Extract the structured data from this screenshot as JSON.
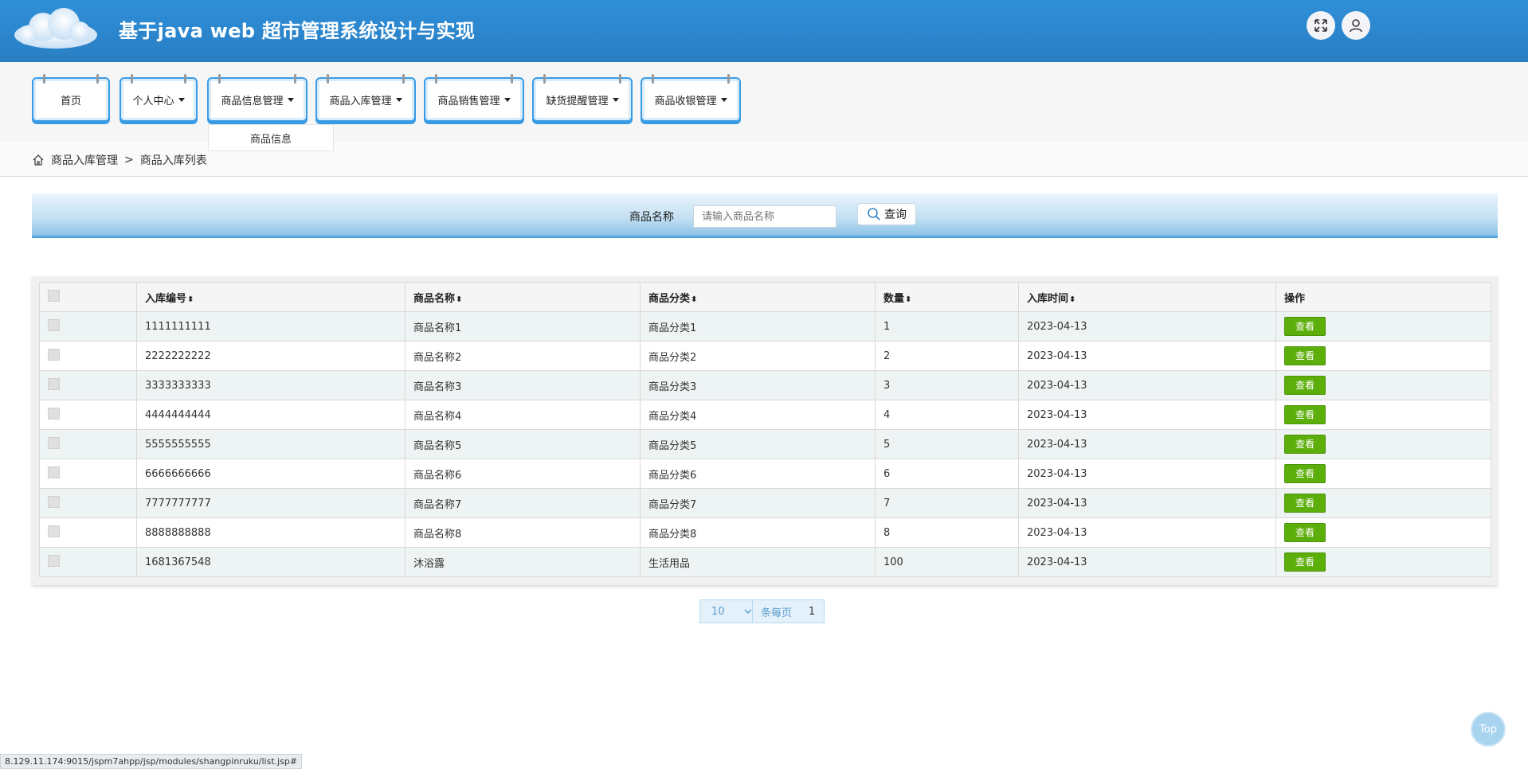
{
  "header": {
    "title": "基于java web 超市管理系统设计与实现",
    "fullscreen_icon": "expand-icon",
    "user_icon": "user-icon"
  },
  "nav": {
    "items": [
      {
        "label": "首页",
        "has_caret": false
      },
      {
        "label": "个人中心",
        "has_caret": true
      },
      {
        "label": "商品信息管理",
        "has_caret": true
      },
      {
        "label": "商品入库管理",
        "has_caret": true
      },
      {
        "label": "商品销售管理",
        "has_caret": true
      },
      {
        "label": "缺货提醒管理",
        "has_caret": true
      },
      {
        "label": "商品收银管理",
        "has_caret": true
      }
    ],
    "open_dropdown": {
      "label": "商品信息"
    }
  },
  "breadcrumb": {
    "home_icon": "home-icon",
    "level1": "商品入库管理",
    "separator": ">",
    "level2": "商品入库列表"
  },
  "search": {
    "label": "商品名称",
    "placeholder": "请输入商品名称",
    "button_label": "查询"
  },
  "table": {
    "headers": [
      "入库编号",
      "商品名称",
      "商品分类",
      "数量",
      "入库时间",
      "操作"
    ],
    "sort_glyph": "⬍",
    "action_label": "查看",
    "rows": [
      {
        "id": "1111111111",
        "name": "商品名称1",
        "category": "商品分类1",
        "qty": "1",
        "date": "2023-04-13"
      },
      {
        "id": "2222222222",
        "name": "商品名称2",
        "category": "商品分类2",
        "qty": "2",
        "date": "2023-04-13"
      },
      {
        "id": "3333333333",
        "name": "商品名称3",
        "category": "商品分类3",
        "qty": "3",
        "date": "2023-04-13"
      },
      {
        "id": "4444444444",
        "name": "商品名称4",
        "category": "商品分类4",
        "qty": "4",
        "date": "2023-04-13"
      },
      {
        "id": "5555555555",
        "name": "商品名称5",
        "category": "商品分类5",
        "qty": "5",
        "date": "2023-04-13"
      },
      {
        "id": "6666666666",
        "name": "商品名称6",
        "category": "商品分类6",
        "qty": "6",
        "date": "2023-04-13"
      },
      {
        "id": "7777777777",
        "name": "商品名称7",
        "category": "商品分类7",
        "qty": "7",
        "date": "2023-04-13"
      },
      {
        "id": "8888888888",
        "name": "商品名称8",
        "category": "商品分类8",
        "qty": "8",
        "date": "2023-04-13"
      },
      {
        "id": "1681367548",
        "name": "沐浴露",
        "category": "生活用品",
        "qty": "100",
        "date": "2023-04-13"
      }
    ]
  },
  "pagination": {
    "page_size": "10",
    "per_page_label": "条每页",
    "current_page": "1"
  },
  "statusbar": {
    "url": "8.129.11.174:9015/jspm7ahpp/jsp/modules/shangpinruku/list.jsp#"
  },
  "top_button": {
    "label": "Top"
  },
  "colors": {
    "header_blue": "#2b85cc",
    "nav_border": "#3a9be5",
    "action_green": "#5cae0a"
  }
}
